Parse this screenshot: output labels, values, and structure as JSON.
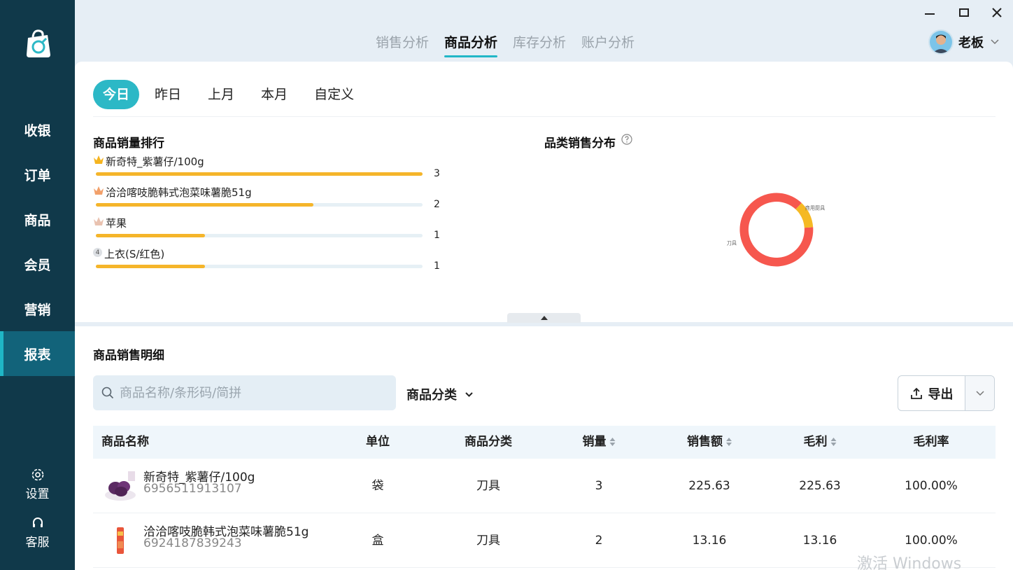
{
  "sidebar": {
    "logo_icon": "shopping-bag-icon",
    "items": [
      {
        "label": "收银"
      },
      {
        "label": "订单"
      },
      {
        "label": "商品"
      },
      {
        "label": "会员"
      },
      {
        "label": "营销"
      },
      {
        "label": "报表",
        "active": true
      }
    ],
    "settings_label": "设置",
    "service_label": "客服"
  },
  "header": {
    "tabs": [
      {
        "label": "销售分析"
      },
      {
        "label": "商品分析",
        "active": true
      },
      {
        "label": "库存分析"
      },
      {
        "label": "账户分析"
      }
    ],
    "user_name": "老板"
  },
  "date_filters": [
    "今日",
    "昨日",
    "上月",
    "本月",
    "自定义"
  ],
  "ranking": {
    "title": "商品销量排行",
    "max": 3,
    "items": [
      {
        "name": "新奇特_紫薯仔/100g",
        "value": 3
      },
      {
        "name": "洽洽喀吱脆韩式泡菜味薯脆51g",
        "value": 2
      },
      {
        "name": "苹果",
        "value": 1
      },
      {
        "rank": "4",
        "name": "上衣(S/红色)",
        "value": 1
      }
    ]
  },
  "category_chart": {
    "title": "品类销售分布"
  },
  "chart_data": {
    "type": "pie",
    "title": "品类销售分布",
    "slices": [
      {
        "label": "刀具",
        "value": 88,
        "color": "#f6574e"
      },
      {
        "label": "商用厨具",
        "value": 12,
        "color": "#f5b924"
      }
    ]
  },
  "detail": {
    "title": "商品销售明细",
    "search_placeholder": "商品名称/条形码/简拼",
    "category_label": "商品分类",
    "export_label": "导出",
    "columns": [
      "商品名称",
      "单位",
      "商品分类",
      "销量",
      "销售额",
      "毛利",
      "毛利率"
    ],
    "rows": [
      {
        "name": "新奇特_紫薯仔/100g",
        "code": "6956511913107",
        "unit": "袋",
        "category": "刀具",
        "qty": "3",
        "sales": "225.63",
        "profit": "225.63",
        "rate": "100.00%"
      },
      {
        "name": "洽洽喀吱脆韩式泡菜味薯脆51g",
        "code": "6924187839243",
        "unit": "盒",
        "category": "刀具",
        "qty": "2",
        "sales": "13.16",
        "profit": "13.16",
        "rate": "100.00%"
      }
    ]
  },
  "watermark": "激活 Windows",
  "colors": {
    "sidebar": "#10394a",
    "accent": "#2cb8c6",
    "bar": "#f5b52a"
  }
}
